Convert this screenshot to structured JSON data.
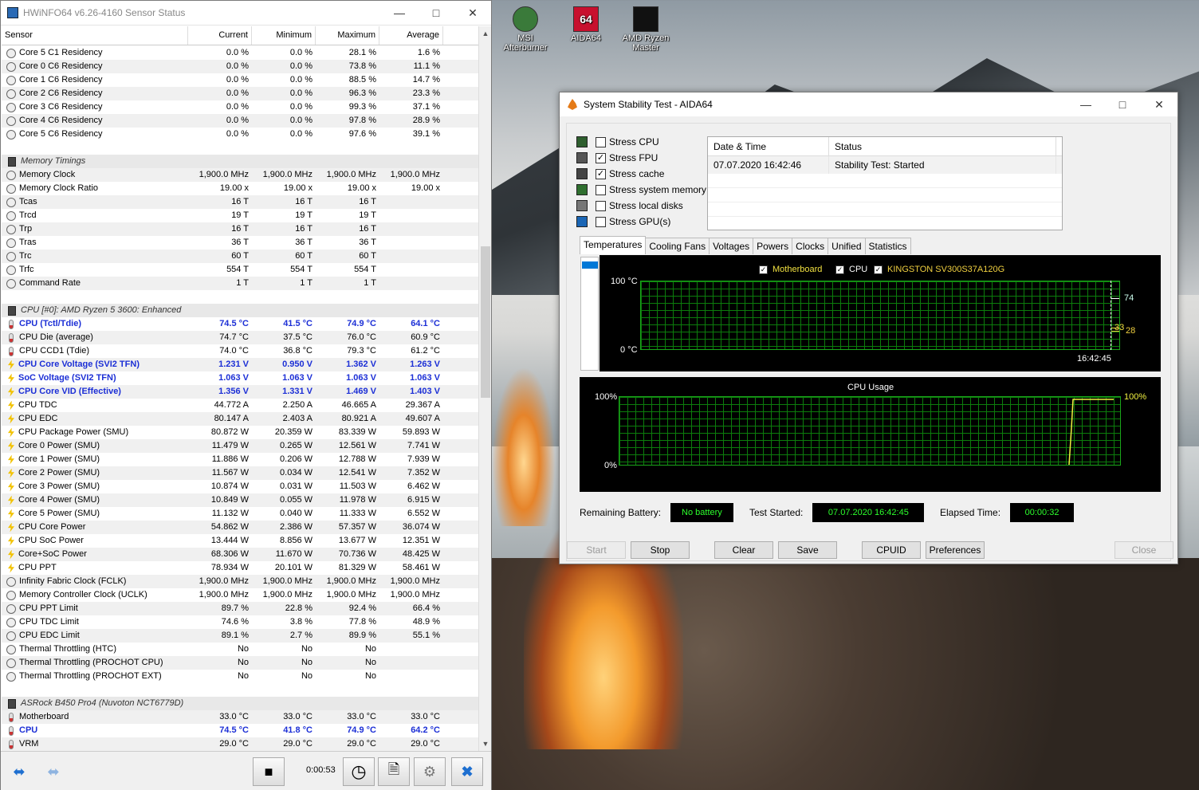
{
  "hwinfo": {
    "title": "HWiNFO64 v6.26-4160 Sensor Status",
    "columns": [
      "Sensor",
      "Current",
      "Minimum",
      "Maximum",
      "Average"
    ],
    "rows": [
      {
        "t": "clock",
        "n": "Core 5 C1 Residency",
        "v": [
          "0.0 %",
          "0.0 %",
          "28.1 %",
          "1.6 %"
        ]
      },
      {
        "t": "clock",
        "n": "Core 0 C6 Residency",
        "v": [
          "0.0 %",
          "0.0 %",
          "73.8 %",
          "11.1 %"
        ]
      },
      {
        "t": "clock",
        "n": "Core 1 C6 Residency",
        "v": [
          "0.0 %",
          "0.0 %",
          "88.5 %",
          "14.7 %"
        ]
      },
      {
        "t": "clock",
        "n": "Core 2 C6 Residency",
        "v": [
          "0.0 %",
          "0.0 %",
          "96.3 %",
          "23.3 %"
        ]
      },
      {
        "t": "clock",
        "n": "Core 3 C6 Residency",
        "v": [
          "0.0 %",
          "0.0 %",
          "99.3 %",
          "37.1 %"
        ]
      },
      {
        "t": "clock",
        "n": "Core 4 C6 Residency",
        "v": [
          "0.0 %",
          "0.0 %",
          "97.8 %",
          "28.9 %"
        ]
      },
      {
        "t": "clock",
        "n": "Core 5 C6 Residency",
        "v": [
          "0.0 %",
          "0.0 %",
          "97.6 %",
          "39.1 %"
        ]
      },
      {
        "t": "empty",
        "n": "",
        "v": [
          "",
          "",
          "",
          ""
        ]
      },
      {
        "t": "sect",
        "n": "Memory Timings",
        "v": [
          "",
          "",
          "",
          ""
        ]
      },
      {
        "t": "clock",
        "n": "Memory Clock",
        "v": [
          "1,900.0 MHz",
          "1,900.0 MHz",
          "1,900.0 MHz",
          "1,900.0 MHz"
        ]
      },
      {
        "t": "clock",
        "n": "Memory Clock Ratio",
        "v": [
          "19.00 x",
          "19.00 x",
          "19.00 x",
          "19.00 x"
        ]
      },
      {
        "t": "clock",
        "n": "Tcas",
        "v": [
          "16 T",
          "16 T",
          "16 T",
          ""
        ]
      },
      {
        "t": "clock",
        "n": "Trcd",
        "v": [
          "19 T",
          "19 T",
          "19 T",
          ""
        ]
      },
      {
        "t": "clock",
        "n": "Trp",
        "v": [
          "16 T",
          "16 T",
          "16 T",
          ""
        ]
      },
      {
        "t": "clock",
        "n": "Tras",
        "v": [
          "36 T",
          "36 T",
          "36 T",
          ""
        ]
      },
      {
        "t": "clock",
        "n": "Trc",
        "v": [
          "60 T",
          "60 T",
          "60 T",
          ""
        ]
      },
      {
        "t": "clock",
        "n": "Trfc",
        "v": [
          "554 T",
          "554 T",
          "554 T",
          ""
        ]
      },
      {
        "t": "clock",
        "n": "Command Rate",
        "v": [
          "1 T",
          "1 T",
          "1 T",
          ""
        ]
      },
      {
        "t": "empty",
        "n": "",
        "v": [
          "",
          "",
          "",
          ""
        ]
      },
      {
        "t": "sect",
        "n": "CPU [#0]: AMD Ryzen 5 3600: Enhanced",
        "v": [
          "",
          "",
          "",
          ""
        ]
      },
      {
        "t": "therm",
        "b": true,
        "n": "CPU (Tctl/Tdie)",
        "v": [
          "74.5 °C",
          "41.5 °C",
          "74.9 °C",
          "64.1 °C"
        ]
      },
      {
        "t": "therm",
        "n": "CPU Die (average)",
        "v": [
          "74.7 °C",
          "37.5 °C",
          "76.0 °C",
          "60.9 °C"
        ]
      },
      {
        "t": "therm",
        "n": "CPU CCD1 (Tdie)",
        "v": [
          "74.0 °C",
          "36.8 °C",
          "79.3 °C",
          "61.2 °C"
        ]
      },
      {
        "t": "bolt",
        "b": true,
        "n": "CPU Core Voltage (SVI2 TFN)",
        "v": [
          "1.231 V",
          "0.950 V",
          "1.362 V",
          "1.263 V"
        ]
      },
      {
        "t": "bolt",
        "b": true,
        "n": "SoC Voltage (SVI2 TFN)",
        "v": [
          "1.063 V",
          "1.063 V",
          "1.063 V",
          "1.063 V"
        ]
      },
      {
        "t": "bolt",
        "b": true,
        "n": "CPU Core VID (Effective)",
        "v": [
          "1.356 V",
          "1.331 V",
          "1.469 V",
          "1.403 V"
        ]
      },
      {
        "t": "bolt",
        "n": "CPU TDC",
        "v": [
          "44.772 A",
          "2.250 A",
          "46.665 A",
          "29.367 A"
        ]
      },
      {
        "t": "bolt",
        "n": "CPU EDC",
        "v": [
          "80.147 A",
          "2.403 A",
          "80.921 A",
          "49.607 A"
        ]
      },
      {
        "t": "bolt",
        "n": "CPU Package Power (SMU)",
        "v": [
          "80.872 W",
          "20.359 W",
          "83.339 W",
          "59.893 W"
        ]
      },
      {
        "t": "bolt",
        "n": "Core 0 Power (SMU)",
        "v": [
          "11.479 W",
          "0.265 W",
          "12.561 W",
          "7.741 W"
        ]
      },
      {
        "t": "bolt",
        "n": "Core 1 Power (SMU)",
        "v": [
          "11.886 W",
          "0.206 W",
          "12.788 W",
          "7.939 W"
        ]
      },
      {
        "t": "bolt",
        "n": "Core 2 Power (SMU)",
        "v": [
          "11.567 W",
          "0.034 W",
          "12.541 W",
          "7.352 W"
        ]
      },
      {
        "t": "bolt",
        "n": "Core 3 Power (SMU)",
        "v": [
          "10.874 W",
          "0.031 W",
          "11.503 W",
          "6.462 W"
        ]
      },
      {
        "t": "bolt",
        "n": "Core 4 Power (SMU)",
        "v": [
          "10.849 W",
          "0.055 W",
          "11.978 W",
          "6.915 W"
        ]
      },
      {
        "t": "bolt",
        "n": "Core 5 Power (SMU)",
        "v": [
          "11.132 W",
          "0.040 W",
          "11.333 W",
          "6.552 W"
        ]
      },
      {
        "t": "bolt",
        "n": "CPU Core Power",
        "v": [
          "54.862 W",
          "2.386 W",
          "57.357 W",
          "36.074 W"
        ]
      },
      {
        "t": "bolt",
        "n": "CPU SoC Power",
        "v": [
          "13.444 W",
          "8.856 W",
          "13.677 W",
          "12.351 W"
        ]
      },
      {
        "t": "bolt",
        "n": "Core+SoC Power",
        "v": [
          "68.306 W",
          "11.670 W",
          "70.736 W",
          "48.425 W"
        ]
      },
      {
        "t": "bolt",
        "n": "CPU PPT",
        "v": [
          "78.934 W",
          "20.101 W",
          "81.329 W",
          "58.461 W"
        ]
      },
      {
        "t": "clock",
        "n": "Infinity Fabric Clock (FCLK)",
        "v": [
          "1,900.0 MHz",
          "1,900.0 MHz",
          "1,900.0 MHz",
          "1,900.0 MHz"
        ]
      },
      {
        "t": "clock",
        "n": "Memory Controller Clock (UCLK)",
        "v": [
          "1,900.0 MHz",
          "1,900.0 MHz",
          "1,900.0 MHz",
          "1,900.0 MHz"
        ]
      },
      {
        "t": "clock",
        "n": "CPU PPT Limit",
        "v": [
          "89.7 %",
          "22.8 %",
          "92.4 %",
          "66.4 %"
        ]
      },
      {
        "t": "clock",
        "n": "CPU TDC Limit",
        "v": [
          "74.6 %",
          "3.8 %",
          "77.8 %",
          "48.9 %"
        ]
      },
      {
        "t": "clock",
        "n": "CPU EDC Limit",
        "v": [
          "89.1 %",
          "2.7 %",
          "89.9 %",
          "55.1 %"
        ]
      },
      {
        "t": "clock",
        "n": "Thermal Throttling (HTC)",
        "v": [
          "No",
          "No",
          "No",
          ""
        ]
      },
      {
        "t": "clock",
        "n": "Thermal Throttling (PROCHOT CPU)",
        "v": [
          "No",
          "No",
          "No",
          ""
        ]
      },
      {
        "t": "clock",
        "n": "Thermal Throttling (PROCHOT EXT)",
        "v": [
          "No",
          "No",
          "No",
          ""
        ]
      },
      {
        "t": "empty",
        "n": "",
        "v": [
          "",
          "",
          "",
          ""
        ]
      },
      {
        "t": "sect",
        "n": "ASRock B450 Pro4 (Nuvoton NCT6779D)",
        "v": [
          "",
          "",
          "",
          ""
        ]
      },
      {
        "t": "therm",
        "n": "Motherboard",
        "v": [
          "33.0 °C",
          "33.0 °C",
          "33.0 °C",
          "33.0 °C"
        ]
      },
      {
        "t": "therm",
        "b": true,
        "n": "CPU",
        "v": [
          "74.5 °C",
          "41.8 °C",
          "74.9 °C",
          "64.2 °C"
        ]
      },
      {
        "t": "therm",
        "n": "VRM",
        "v": [
          "29.0 °C",
          "29.0 °C",
          "29.0 °C",
          "29.0 °C"
        ]
      }
    ],
    "timer": "0:00:53"
  },
  "desktop": {
    "icons": [
      {
        "label": "MSI Afterburner",
        "color": "#3a7a3a"
      },
      {
        "label": "AIDA64",
        "color": "#c8102e"
      },
      {
        "label": "AMD Ryzen Master",
        "color": "#111111"
      }
    ]
  },
  "aida": {
    "title": "System Stability Test - AIDA64",
    "options": [
      {
        "label": "Stress CPU",
        "checked": false
      },
      {
        "label": "Stress FPU",
        "checked": true
      },
      {
        "label": "Stress cache",
        "checked": true
      },
      {
        "label": "Stress system memory",
        "checked": false
      },
      {
        "label": "Stress local disks",
        "checked": false
      },
      {
        "label": "Stress GPU(s)",
        "checked": false
      }
    ],
    "status_header": [
      "Date & Time",
      "Status"
    ],
    "status_row": [
      "07.07.2020 16:42:46",
      "Stability Test: Started"
    ],
    "tabs": [
      "Temperatures",
      "Cooling Fans",
      "Voltages",
      "Powers",
      "Clocks",
      "Unified",
      "Statistics"
    ],
    "temp_legend": [
      {
        "label": "Motherboard",
        "color": "#f0e040"
      },
      {
        "label": "CPU",
        "color": "#ffffff"
      },
      {
        "label": "KINGSTON SV300S37A120G",
        "color": "#f0d040"
      }
    ],
    "temp_axis_top": "100 °C",
    "temp_axis_bottom": "0 °C",
    "temp_time": "16:42:45",
    "temp_val_cpu": "74",
    "temp_val_mb": "33",
    "temp_val_ssd": "28",
    "usage_title": "CPU Usage",
    "usage_top": "100%",
    "usage_bottom": "0%",
    "usage_val": "100%",
    "battery_label": "Remaining Battery:",
    "battery_value": "No battery",
    "started_label": "Test Started:",
    "started_value": "07.07.2020 16:42:45",
    "elapsed_label": "Elapsed Time:",
    "elapsed_value": "00:00:32",
    "buttons": {
      "start": "Start",
      "stop": "Stop",
      "clear": "Clear",
      "save": "Save",
      "cpuid": "CPUID",
      "prefs": "Preferences",
      "close": "Close"
    }
  }
}
